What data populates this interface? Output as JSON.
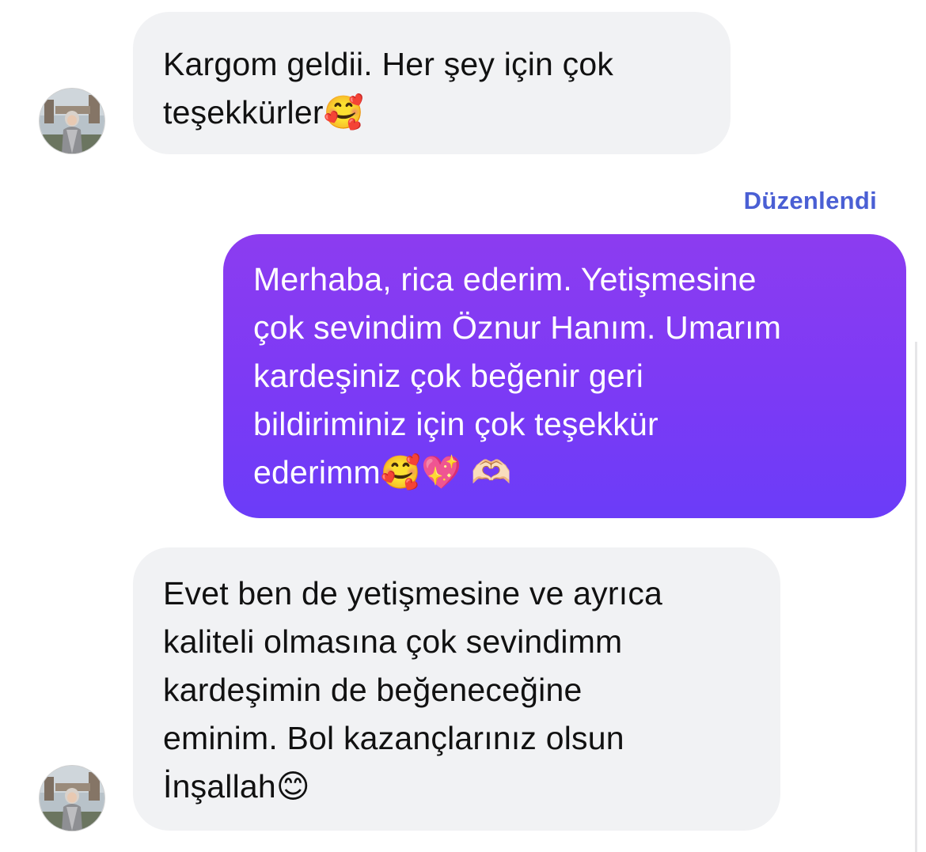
{
  "conversation": {
    "messages": [
      {
        "sender": "contact",
        "text": "Kargom geldii. Her şey için çok\nteşekkürler🥰"
      },
      {
        "sender": "me",
        "text": "Merhaba, rica ederim. Yetişmesine\nçok sevindim Öznur Hanım. Umarım\nkardeşiniz çok beğenir geri\nbildiriminiz için çok teşekkür\nederimm🥰💖 🫶🏻"
      },
      {
        "sender": "contact",
        "text": "Evet ben de yetişmesine ve ayrıca\nkaliteli olmasına çok sevindimm\nkardeşimin de beğeneceğine\neminim. Bol kazançlarınız olsun\nİnşallah😊"
      }
    ],
    "edited_label": "Düzenlendi"
  },
  "theme": {
    "incoming_bubble": "#f1f2f4",
    "outgoing_gradient": [
      "#8c3cf0",
      "#6b3cf8"
    ],
    "edited_label_color": "#4a5fd4"
  },
  "icons": {
    "contact_avatar": "contact-avatar-photo"
  }
}
